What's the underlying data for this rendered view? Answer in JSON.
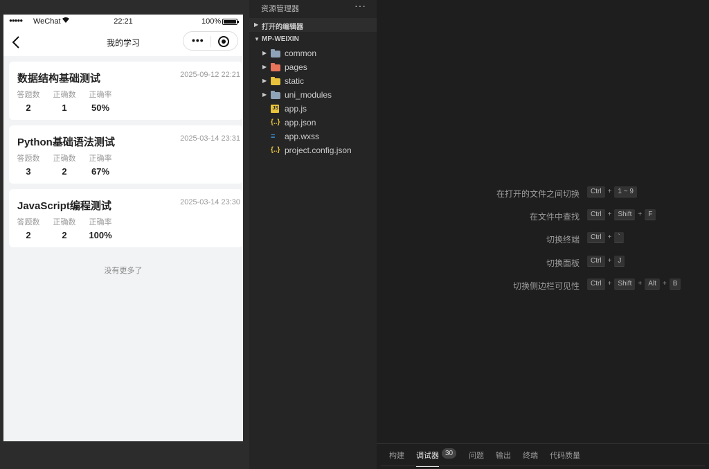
{
  "statusbar": {
    "signal": "●●●●●",
    "carrier": "WeChat",
    "time": "22:21",
    "battery_pct": "100%",
    "battery_level": 1.0
  },
  "navbar": {
    "title": "我的学习"
  },
  "records": [
    {
      "title": "数据结构基础测试",
      "date": "2025-09-12 22:21",
      "stats": [
        {
          "label": "答题数",
          "value": "2"
        },
        {
          "label": "正确数",
          "value": "1"
        },
        {
          "label": "正确率",
          "value": "50%"
        }
      ]
    },
    {
      "title": "Python基础语法测试",
      "date": "2025-03-14 23:31",
      "stats": [
        {
          "label": "答题数",
          "value": "3"
        },
        {
          "label": "正确数",
          "value": "2"
        },
        {
          "label": "正确率",
          "value": "67%"
        }
      ]
    },
    {
      "title": "JavaScript编程测试",
      "date": "2025-03-14 23:30",
      "stats": [
        {
          "label": "答题数",
          "value": "2"
        },
        {
          "label": "正确数",
          "value": "2"
        },
        {
          "label": "正确率",
          "value": "100%"
        }
      ]
    }
  ],
  "list_end": "没有更多了",
  "explorer": {
    "title": "资源管理器",
    "more": "···",
    "open_editors": "打开的编辑器",
    "project": "MP-WEIXIN",
    "items": [
      {
        "label": "common",
        "icon": "folder-icon",
        "color": "#8fa3b8"
      },
      {
        "label": "pages",
        "icon": "folder-pages-icon",
        "color": "#e8755a"
      },
      {
        "label": "static",
        "icon": "folder-static-icon",
        "color": "#e8c33b"
      },
      {
        "label": "uni_modules",
        "icon": "folder-icon",
        "color": "#8fa3b8"
      },
      {
        "label": "app.js",
        "icon": "js-file-icon",
        "glyph": "JS"
      },
      {
        "label": "app.json",
        "icon": "json-file-icon",
        "glyph": "{..}"
      },
      {
        "label": "app.wxss",
        "icon": "css-file-icon",
        "glyph": "≡"
      },
      {
        "label": "project.config.json",
        "icon": "json-file-icon",
        "glyph": "{..}"
      }
    ]
  },
  "shortcuts": [
    {
      "name": "在打开的文件之间切换",
      "keys": [
        "Ctrl",
        "1 ~ 9"
      ]
    },
    {
      "name": "在文件中查找",
      "keys": [
        "Ctrl",
        "Shift",
        "F"
      ]
    },
    {
      "name": "切换终端",
      "keys": [
        "Ctrl",
        "`"
      ]
    },
    {
      "name": "切换面板",
      "keys": [
        "Ctrl",
        "J"
      ]
    },
    {
      "name": "切换侧边栏可见性",
      "keys": [
        "Ctrl",
        "Shift",
        "Alt",
        "B"
      ]
    }
  ],
  "panel": {
    "tabs": [
      "构建",
      "调试器",
      "问题",
      "输出",
      "终端",
      "代码质量"
    ],
    "active_tab": "调试器",
    "debugger_badge": "30"
  },
  "colors": {
    "phone_bg": "#f2f3f5",
    "editor_bg": "#1e1e1e",
    "explorer_bg": "#252526"
  }
}
